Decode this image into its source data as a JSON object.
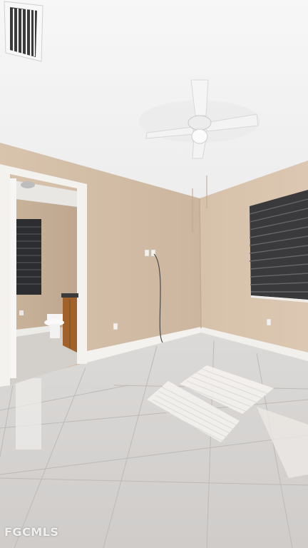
{
  "photo": {
    "subject": "empty-room-interior",
    "watermark": "FGCMLS"
  },
  "colors": {
    "ceiling": "#f2f2f2",
    "wall": "#d7c2ab",
    "wall_shadow": "#c8b29b",
    "floor": "#d8d5d2",
    "baseboard": "#f4f2ee",
    "blinds": "#3a3a3c"
  }
}
